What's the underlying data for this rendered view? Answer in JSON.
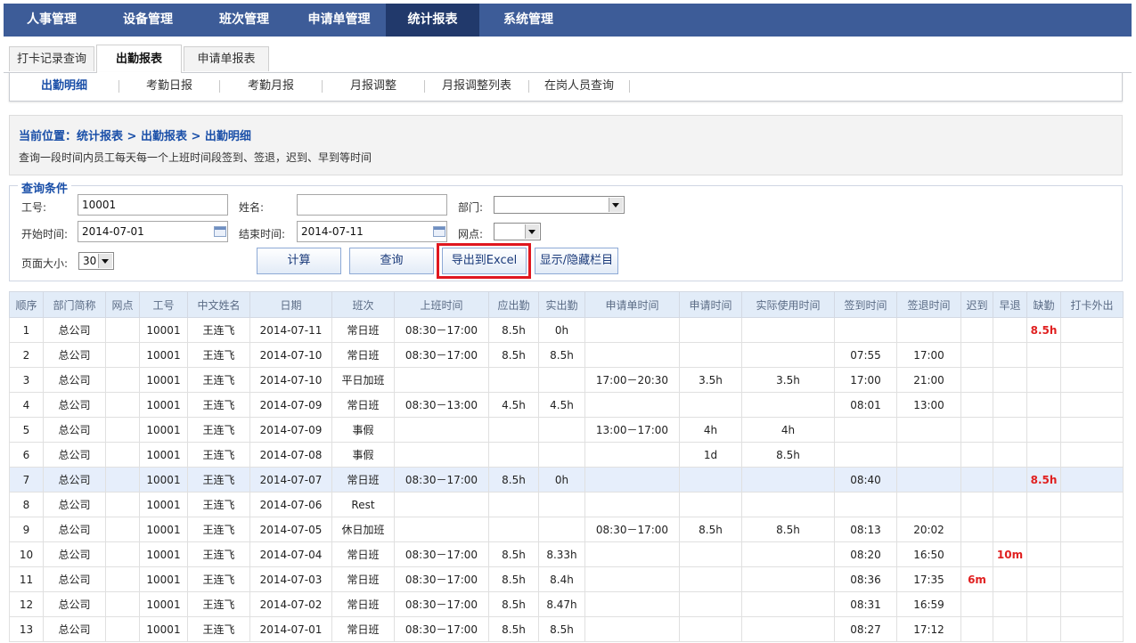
{
  "top_nav": [
    {
      "label": "人事管理",
      "active": false
    },
    {
      "label": "设备管理",
      "active": false
    },
    {
      "label": "班次管理",
      "active": false
    },
    {
      "label": "申请单管理",
      "active": false
    },
    {
      "label": "统计报表",
      "active": true
    },
    {
      "label": "系统管理",
      "active": false
    }
  ],
  "tabs": [
    {
      "label": "打卡记录查询",
      "active": false
    },
    {
      "label": "出勤报表",
      "active": true
    },
    {
      "label": "申请单报表",
      "active": false
    }
  ],
  "sub_nav": [
    {
      "label": "出勤明细",
      "active": true
    },
    {
      "label": "考勤日报",
      "active": false
    },
    {
      "label": "考勤月报",
      "active": false
    },
    {
      "label": "月报调整",
      "active": false
    },
    {
      "label": "月报调整列表",
      "active": false
    },
    {
      "label": "在岗人员查询",
      "active": false
    }
  ],
  "breadcrumb": "当前位置：统计报表 > 出勤报表 > 出勤明细",
  "description": "查询一段时间内员工每天每一个上班时间段签到、签退，迟到、早到等时间",
  "query": {
    "legend": "查询条件",
    "emp_no_label": "工号:",
    "emp_no_value": "10001",
    "name_label": "姓名:",
    "name_value": "",
    "dept_label": "部门:",
    "dept_value": "",
    "start_label": "开始时间:",
    "start_value": "2014-07-01",
    "end_label": "结束时间:",
    "end_value": "2014-07-11",
    "site_label": "网点:",
    "site_value": "",
    "page_size_label": "页面大小:",
    "page_size_value": "30"
  },
  "buttons": {
    "calc": "计算",
    "search": "查询",
    "export": "导出到Excel",
    "toggle_cols": "显示/隐藏栏目"
  },
  "table": {
    "columns": [
      "顺序",
      "部门简称",
      "网点",
      "工号",
      "中文姓名",
      "日期",
      "班次",
      "上班时间",
      "应出勤",
      "实出勤",
      "申请单时间",
      "申请时间",
      "实际使用时间",
      "签到时间",
      "签退时间",
      "迟到",
      "早退",
      "缺勤",
      "打卡外出"
    ],
    "rows": [
      [
        "1",
        "总公司",
        "",
        "10001",
        "王连飞",
        "2014-07-11",
        "常日班",
        "08:30－17:00",
        "8.5h",
        "0h",
        "",
        "",
        "",
        "",
        "",
        "",
        "",
        "8.5h",
        ""
      ],
      [
        "2",
        "总公司",
        "",
        "10001",
        "王连飞",
        "2014-07-10",
        "常日班",
        "08:30－17:00",
        "8.5h",
        "8.5h",
        "",
        "",
        "",
        "07:55",
        "17:00",
        "",
        "",
        "",
        ""
      ],
      [
        "3",
        "总公司",
        "",
        "10001",
        "王连飞",
        "2014-07-10",
        "平日加班",
        "",
        "",
        "",
        "17:00－20:30",
        "3.5h",
        "3.5h",
        "17:00",
        "21:00",
        "",
        "",
        "",
        ""
      ],
      [
        "4",
        "总公司",
        "",
        "10001",
        "王连飞",
        "2014-07-09",
        "常日班",
        "08:30－13:00",
        "4.5h",
        "4.5h",
        "",
        "",
        "",
        "08:01",
        "13:00",
        "",
        "",
        "",
        ""
      ],
      [
        "5",
        "总公司",
        "",
        "10001",
        "王连飞",
        "2014-07-09",
        "事假",
        "",
        "",
        "",
        "13:00－17:00",
        "4h",
        "4h",
        "",
        "",
        "",
        "",
        "",
        ""
      ],
      [
        "6",
        "总公司",
        "",
        "10001",
        "王连飞",
        "2014-07-08",
        "事假",
        "",
        "",
        "",
        "",
        "1d",
        "8.5h",
        "",
        "",
        "",
        "",
        "",
        ""
      ],
      [
        "7",
        "总公司",
        "",
        "10001",
        "王连飞",
        "2014-07-07",
        "常日班",
        "08:30－17:00",
        "8.5h",
        "0h",
        "",
        "",
        "",
        "08:40",
        "",
        "",
        "",
        "8.5h",
        ""
      ],
      [
        "8",
        "总公司",
        "",
        "10001",
        "王连飞",
        "2014-07-06",
        "Rest",
        "",
        "",
        "",
        "",
        "",
        "",
        "",
        "",
        "",
        "",
        "",
        ""
      ],
      [
        "9",
        "总公司",
        "",
        "10001",
        "王连飞",
        "2014-07-05",
        "休日加班",
        "",
        "",
        "",
        "08:30－17:00",
        "8.5h",
        "8.5h",
        "08:13",
        "20:02",
        "",
        "",
        "",
        ""
      ],
      [
        "10",
        "总公司",
        "",
        "10001",
        "王连飞",
        "2014-07-04",
        "常日班",
        "08:30－17:00",
        "8.5h",
        "8.33h",
        "",
        "",
        "",
        "08:20",
        "16:50",
        "",
        "10m",
        "",
        ""
      ],
      [
        "11",
        "总公司",
        "",
        "10001",
        "王连飞",
        "2014-07-03",
        "常日班",
        "08:30－17:00",
        "8.5h",
        "8.4h",
        "",
        "",
        "",
        "08:36",
        "17:35",
        "6m",
        "",
        "",
        ""
      ],
      [
        "12",
        "总公司",
        "",
        "10001",
        "王连飞",
        "2014-07-02",
        "常日班",
        "08:30－17:00",
        "8.5h",
        "8.47h",
        "",
        "",
        "",
        "08:31",
        "16:59",
        "",
        "",
        "",
        ""
      ],
      [
        "13",
        "总公司",
        "",
        "10001",
        "王连飞",
        "2014-07-01",
        "常日班",
        "08:30－17:00",
        "8.5h",
        "8.5h",
        "",
        "",
        "",
        "08:27",
        "17:12",
        "",
        "",
        "",
        ""
      ]
    ],
    "highlight_row": 6,
    "red_columns": [
      15,
      16,
      17
    ]
  }
}
